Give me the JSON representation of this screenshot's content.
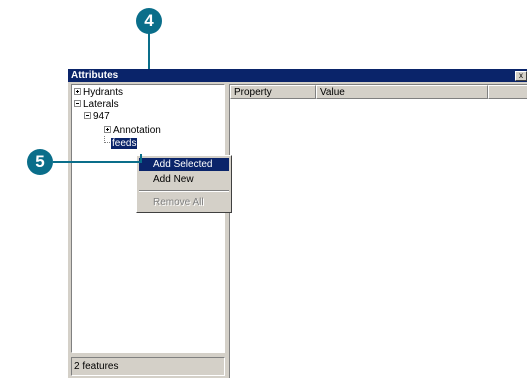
{
  "window": {
    "title": "Attributes",
    "close_glyph": "x"
  },
  "tree": {
    "nodes": [
      {
        "label": "Hydrants"
      },
      {
        "label": "Laterals"
      },
      {
        "label": "947"
      },
      {
        "label": "Annotation"
      },
      {
        "label": "feeds"
      }
    ]
  },
  "status": {
    "text": "2 features"
  },
  "grid": {
    "columns": [
      "Property",
      "Value",
      ""
    ]
  },
  "context_menu": {
    "items": [
      "Add Selected",
      "Add New",
      "Remove All"
    ]
  },
  "callouts": {
    "a": "4",
    "b": "5"
  },
  "colors": {
    "callout": "#0a6e8a",
    "titlebar": "#0a246a",
    "highlight": "#0a246a"
  }
}
